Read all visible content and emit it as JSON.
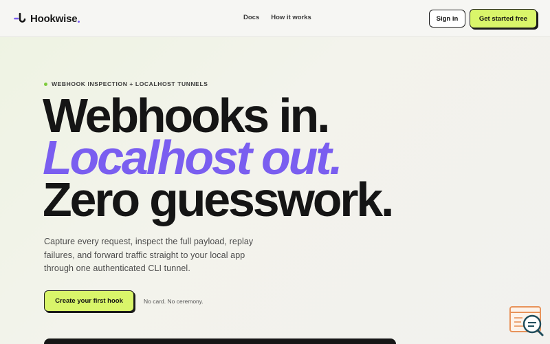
{
  "brand": {
    "name": "Hookwise",
    "accent": "#7a5ef0",
    "cta_color": "#d9f56a"
  },
  "nav": {
    "links": [
      "Docs",
      "How it works"
    ],
    "sign_in": "Sign in",
    "get_started": "Get started free"
  },
  "hero": {
    "eyebrow": "WEBHOOK INSPECTION + LOCALHOST TUNNELS",
    "headline": {
      "line1": "Webhooks in.",
      "line2": "Localhost out.",
      "line3": "Zero guesswork."
    },
    "lede": "Capture every request, inspect the full payload, replay failures, and forward traffic straight to your local app through one authenticated CLI tunnel.",
    "cta": "Create your first hook",
    "cta_note": "No card. No ceremony."
  },
  "icons": {
    "logo": "hook-logo-icon",
    "status_dot": "status-dot-icon",
    "feedback": "feedback-chat-icon"
  }
}
